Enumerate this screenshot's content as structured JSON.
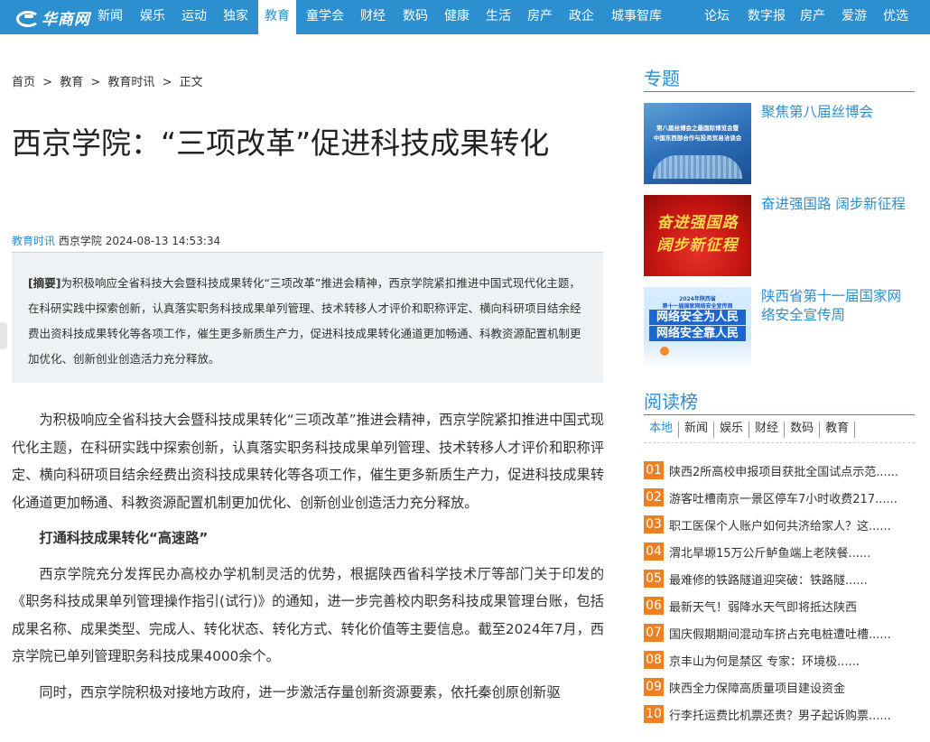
{
  "nav": {
    "logo_text": "华商网",
    "items": [
      "新闻",
      "娱乐",
      "运动",
      "独家",
      "教育",
      "童学会",
      "财经",
      "数码",
      "健康",
      "生活",
      "房产",
      "政企",
      "城事智库"
    ],
    "right_items": [
      "论坛",
      "数字报",
      "房产",
      "爱游",
      "优选"
    ],
    "active": "教育"
  },
  "breadcrumb": [
    "首页",
    ">",
    "教育",
    ">",
    "教育时讯",
    ">",
    "正文"
  ],
  "article": {
    "title": "西京学院：“三项改革”促进科技成果转化",
    "channel": "教育时讯",
    "source": "西京学院",
    "datetime": "2024-08-13 14:53:34",
    "summary_label": "[摘要]",
    "summary": "为积极响应全省科技大会暨科技成果转化“三项改革”推进会精神，西京学院紧扣推进中国式现代化主题，在科研实践中探索创新，认真落实职务科技成果单列管理、技术转移人才评价和职称评定、横向科研项目结余经费出资科技成果转化等各项工作，催生更多新质生产力，促进科技成果转化通道更加畅通、科教资源配置机制更加优化、创新创业创造活力充分释放。",
    "paragraphs": [
      "为积极响应全省科技大会暨科技成果转化“三项改革”推进会精神，西京学院紧扣推进中国式现代化主题，在科研实践中探索创新，认真落实职务科技成果单列管理、技术转移人才评价和职称评定、横向科研项目结余经费出资科技成果转化等各项工作，催生更多新质生产力，促进科技成果转化通道更加畅通、科教资源配置机制更加优化、创新创业创造活力充分释放。",
      "打通科技成果转化“高速路”",
      "西京学院充分发挥民办高校办学机制灵活的优势，根据陕西省科学技术厅等部门关于印发的《职务科技成果单列管理操作指引(试行)》的通知，进一步完善校内职务科技成果管理台账，包括成果名称、成果类型、完成人、转化状态、转化方式、转化价值等主要信息。截至2024年7月，西京学院已单列管理职务科技成果4000余个。",
      "同时，西京学院积极对接地方政府，进一步激活存量创新资源要素，依托秦创原创新驱"
    ]
  },
  "sidebar": {
    "topics_heading": "专题",
    "topics": [
      {
        "title": "聚焦第八届丝博会",
        "thumb_line1": "第八届丝博会之最国际博览会暨",
        "thumb_line2": "中国东西部合作与投资贸易洽谈会"
      },
      {
        "title": "奋进强国路 阔步新征程",
        "thumb_line1": "奋进强国路",
        "thumb_line2": "阔步新征程"
      },
      {
        "title": "陕西省第十一届国家网络安全宣传周",
        "thumb_line1": "2024年陕西省",
        "thumb_line2": "第十一届国家网络安全宣传周",
        "thumb_big1": "网络安全为人民",
        "thumb_big2": "网络安全靠人民"
      }
    ],
    "reading_heading": "阅读榜",
    "reading_tabs": [
      "本地",
      "新闻",
      "娱乐",
      "财经",
      "数码",
      "教育"
    ],
    "reading_active": "本地",
    "ranks": [
      {
        "num": "01",
        "text": "陕西2所高校申报项目获批全国试点示范......"
      },
      {
        "num": "02",
        "text": "游客吐槽南京一景区停车7小时收费217......"
      },
      {
        "num": "03",
        "text": "职工医保个人账户如何共济给家人？这......"
      },
      {
        "num": "04",
        "text": "渭北旱塬15万公斤鲈鱼端上老陕餐......"
      },
      {
        "num": "05",
        "text": "最难修的铁路隧道迎突破：铁路隧......"
      },
      {
        "num": "06",
        "text": "最新天气！弱降水天气即将抵达陕西"
      },
      {
        "num": "07",
        "text": "国庆假期期间混动车挤占充电桩遭吐槽......"
      },
      {
        "num": "08",
        "text": "京丰山为何是禁区 专家：环境极......"
      },
      {
        "num": "09",
        "text": "陕西全力保障高质量项目建设资金"
      },
      {
        "num": "10",
        "text": "行李托运费比机票还贵？男子起诉购票......"
      }
    ]
  }
}
